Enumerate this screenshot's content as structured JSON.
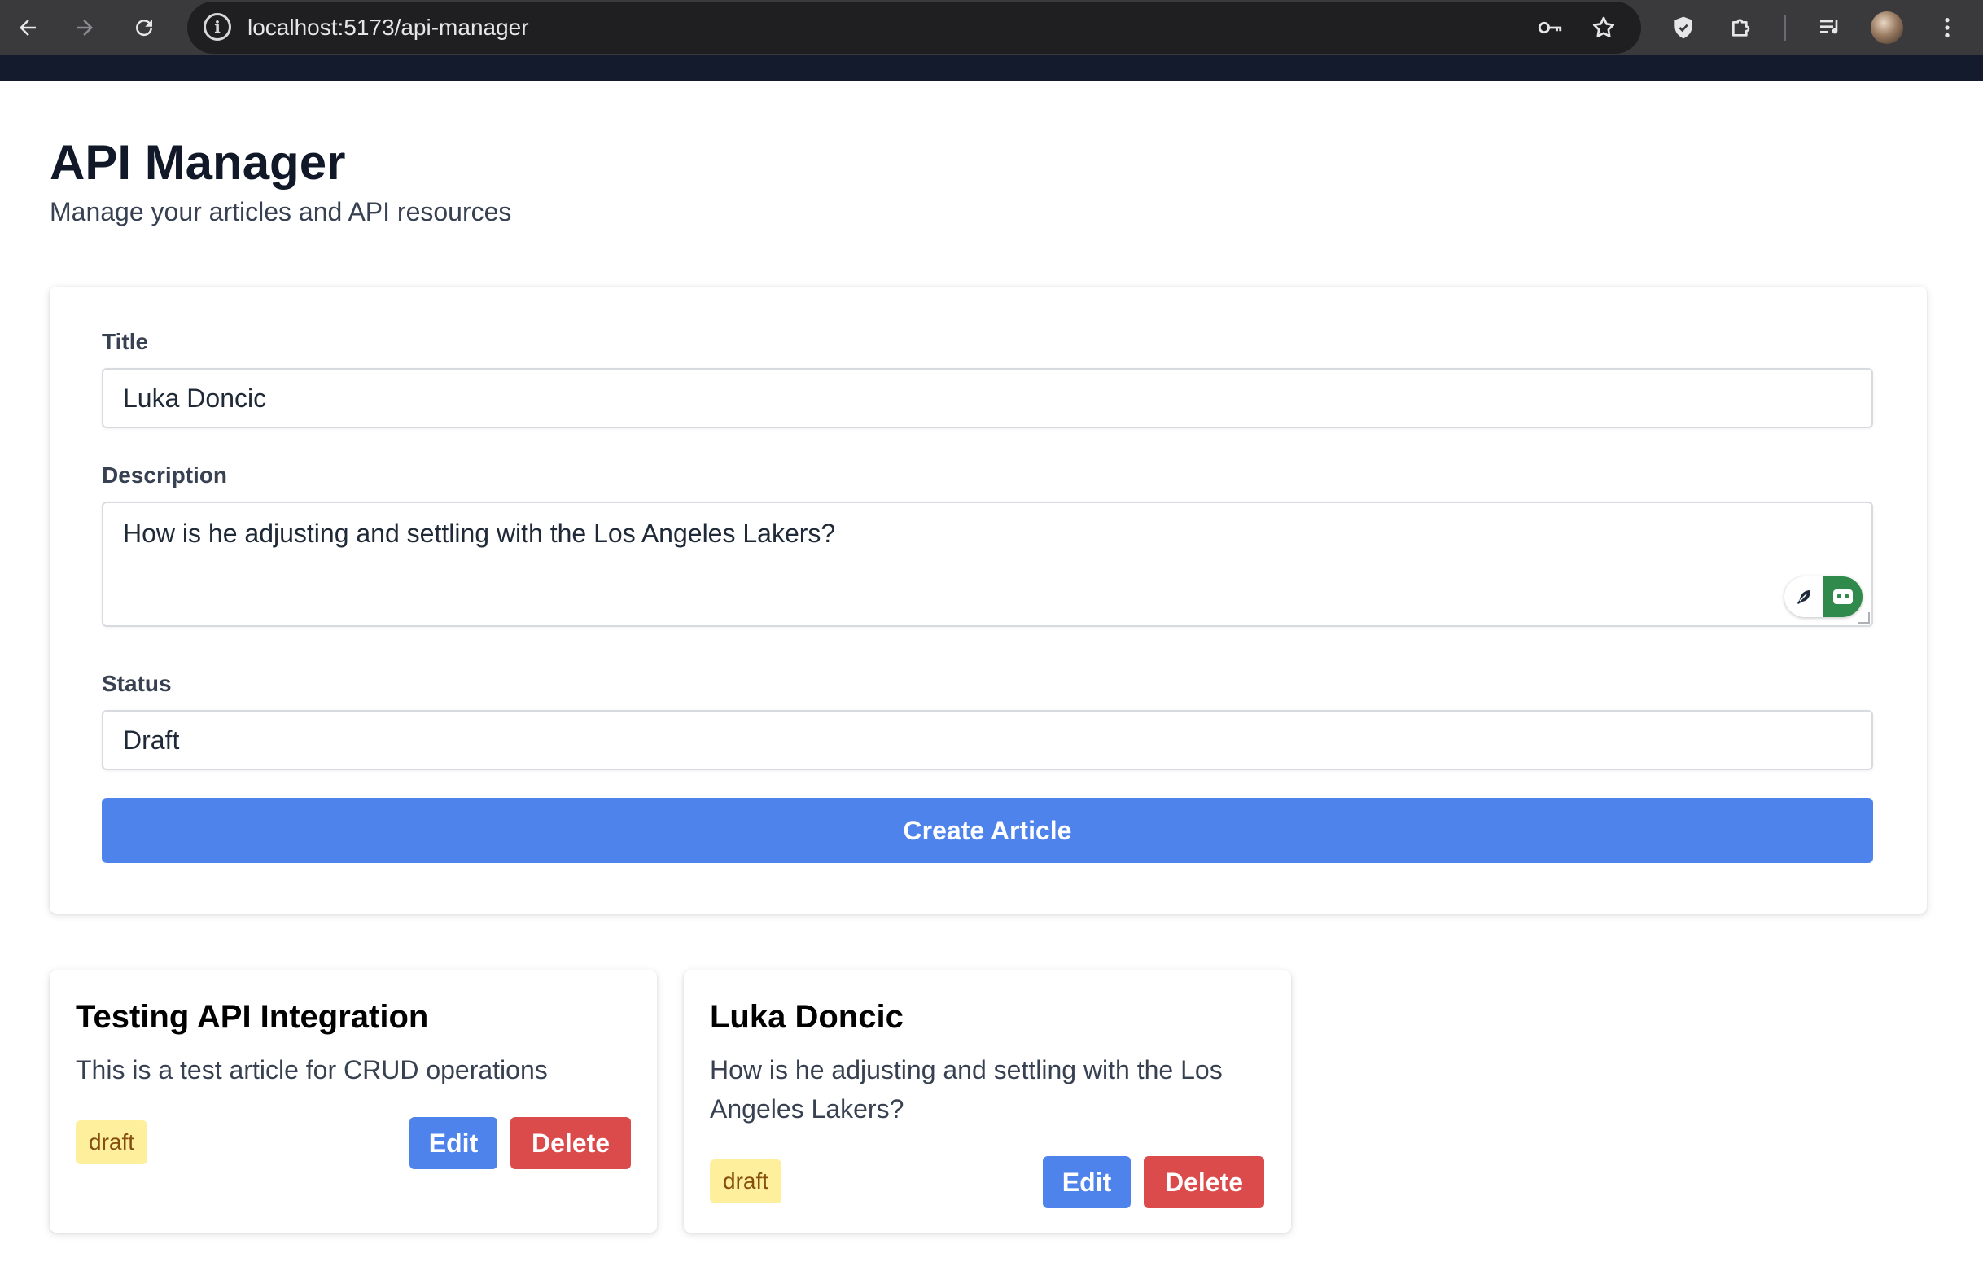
{
  "browser": {
    "url": "localhost:5173/api-manager",
    "back_icon": "arrow-left-icon",
    "forward_icon": "arrow-right-icon",
    "reload_icon": "reload-icon",
    "site_info_icon": "info-icon",
    "key_icon": "key-icon",
    "bookmark_icon": "star-icon",
    "shield_icon": "shield-icon",
    "extensions_icon": "puzzle-icon",
    "media_icon": "media-queue-icon",
    "menu_icon": "kebab-menu-icon"
  },
  "page": {
    "title": "API Manager",
    "subtitle": "Manage your articles and API resources"
  },
  "form": {
    "title_label": "Title",
    "title_value": "Luka Doncic",
    "description_label": "Description",
    "description_value": "How is he adjusting and settling with the Los Angeles Lakers?",
    "status_label": "Status",
    "status_value": "Draft",
    "submit_label": "Create Article"
  },
  "articles": [
    {
      "title": "Testing API Integration",
      "description": "This is a test article for CRUD operations",
      "status": "draft",
      "edit_label": "Edit",
      "delete_label": "Delete"
    },
    {
      "title": "Luka Doncic",
      "description": "How is he adjusting and settling with the Los Angeles Lakers?",
      "status": "draft",
      "edit_label": "Edit",
      "delete_label": "Delete"
    }
  ],
  "colors": {
    "primary": "#4f83ec",
    "danger": "#dc4b4b",
    "badge_bg": "#fdef9c",
    "badge_text": "#854d0e",
    "header_strip": "#141b2c"
  }
}
